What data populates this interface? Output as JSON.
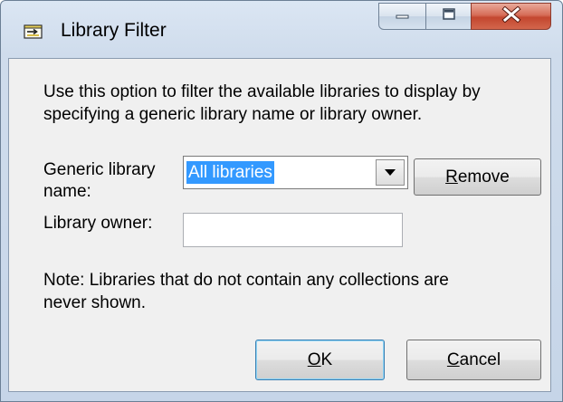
{
  "window": {
    "title": "Library Filter",
    "app_icon": "filter-window-icon"
  },
  "caption_buttons": {
    "minimize_icon": "minimize-icon",
    "maximize_icon": "maximize-icon",
    "close_icon": "close-icon"
  },
  "description": "Use this option to filter the available libraries to display by specifying a generic library name or library owner.",
  "generic_name": {
    "label": "Generic library name:",
    "value": "All libraries",
    "dropdown_icon": "dropdown-arrow-icon"
  },
  "owner": {
    "label": "Library owner:",
    "value": ""
  },
  "remove_button": {
    "accel": "R",
    "rest": "emove"
  },
  "note": "Note: Libraries that do not contain any collections are never shown.",
  "ok_button": {
    "accel": "O",
    "rest": "K"
  },
  "cancel_button": {
    "accel": "C",
    "rest": "ancel"
  },
  "colors": {
    "selection": "#3399ff",
    "close_button": "#c94a33",
    "dialog_background": "#f0f0f0"
  }
}
